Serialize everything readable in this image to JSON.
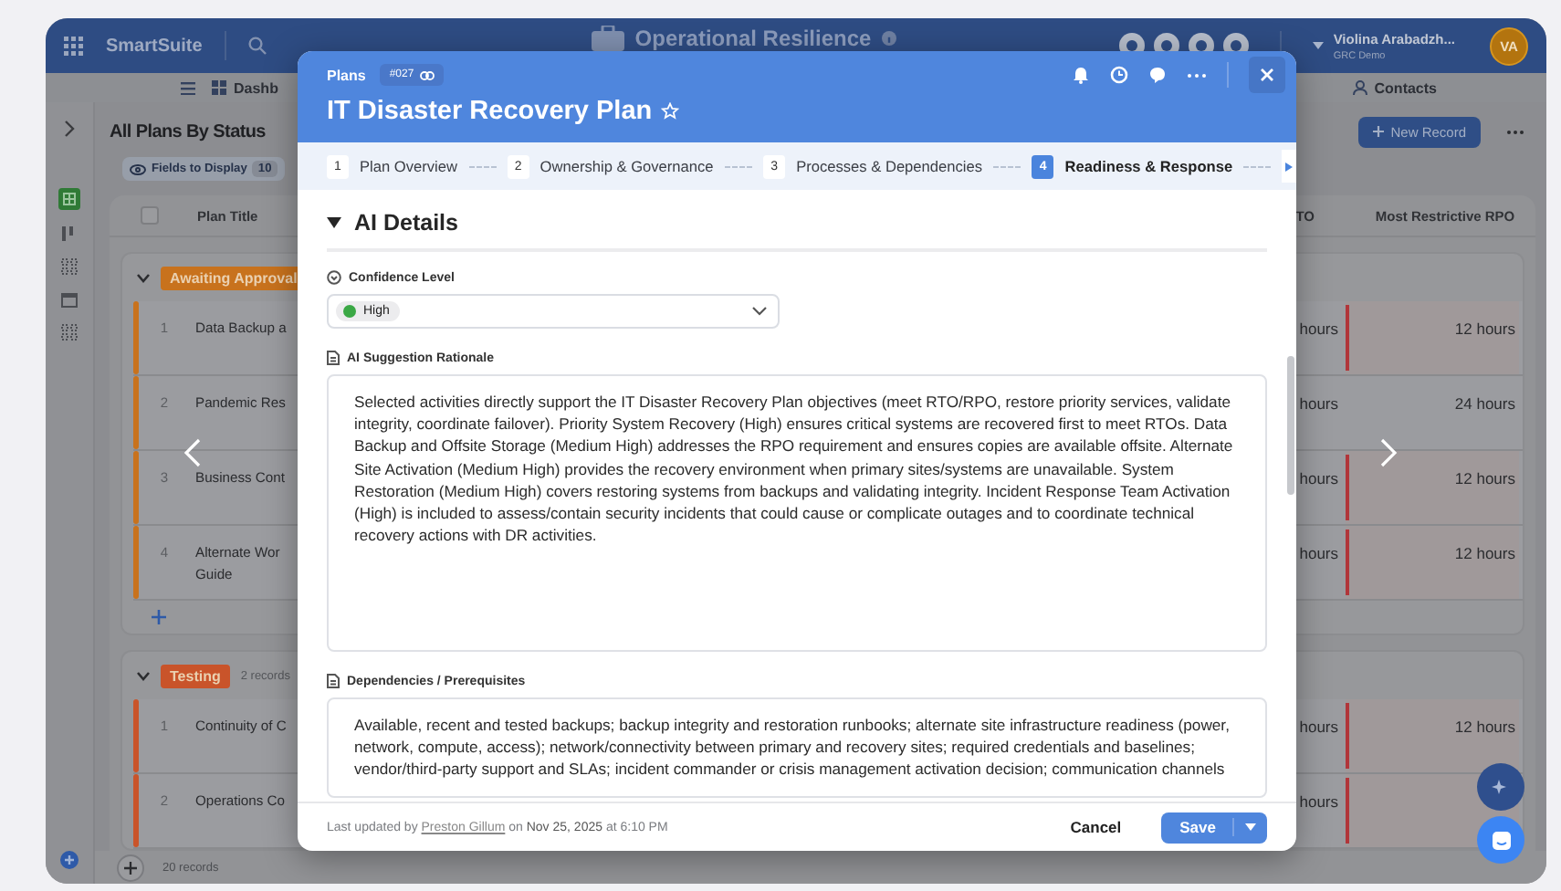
{
  "app": {
    "name": "SmartSuite",
    "workspace": "Operational Resilience",
    "user_name": "Violina Arabadzh...",
    "user_org": "GRC Demo",
    "avatar_initials": "VA"
  },
  "nav": [
    {
      "label": "Dashb"
    },
    {
      "label": "Contacts"
    }
  ],
  "view": {
    "title": "All Plans By Status",
    "fields_button": "Fields to Display",
    "fields_count": "10",
    "new_record_button": "New Record",
    "columns": [
      "Plan Title",
      "TO",
      "Most Restrictive RPO"
    ],
    "select_all_checked": false,
    "groups": [
      {
        "status": "Awaiting Approval",
        "color": "#c8721d",
        "expanded": true,
        "rows": [
          {
            "number": "1",
            "title": "Data Backup a",
            "rto": "hours",
            "rpo": "12 hours",
            "flagged": true
          },
          {
            "number": "2",
            "title": "Pandemic Res",
            "rto": "hours",
            "rpo": "24 hours",
            "flagged": false
          },
          {
            "number": "3",
            "title": "Business Cont",
            "rto": "hours",
            "rpo": "12 hours",
            "flagged": true
          },
          {
            "number": "4",
            "title": "Alternate Wor\nGuide",
            "rto": "hours",
            "rpo": "12 hours",
            "flagged": true
          }
        ]
      },
      {
        "status": "Testing",
        "color": "#c9542a",
        "expanded": true,
        "count": "2 records",
        "rows": [
          {
            "number": "1",
            "title": "Continuity of C",
            "rto": "hours",
            "rpo": "12 hours",
            "flagged": true
          },
          {
            "number": "2",
            "title": "Operations Co",
            "rto": "hours",
            "flagged": true
          }
        ]
      }
    ],
    "record_count": "20 records"
  },
  "modal": {
    "breadcrumb": "Plans",
    "record_id": "#027",
    "title": "IT Disaster Recovery Plan",
    "steps": [
      {
        "number": "1",
        "label": "Plan Overview",
        "selected": false
      },
      {
        "number": "2",
        "label": "Ownership & Governance",
        "selected": false
      },
      {
        "number": "3",
        "label": "Processes & Dependencies",
        "selected": false
      },
      {
        "number": "4",
        "label": "Readiness & Response",
        "selected": true
      }
    ],
    "section": {
      "title": "AI Details",
      "expanded": true
    },
    "fields": [
      {
        "kind": "select",
        "label": "Confidence Level",
        "value": "High",
        "color": "#3aa845"
      },
      {
        "kind": "textarea",
        "label": "AI Suggestion Rationale",
        "value": "Selected activities directly support the IT Disaster Recovery Plan objectives (meet RTO/RPO, restore priority services, validate integrity, coordinate failover). Priority System Recovery (High) ensures critical systems are recovered first to meet RTOs. Data Backup and Offsite Storage (Medium High) addresses the RPO requirement and ensures copies are available offsite. Alternate Site Activation (Medium High) provides the recovery environment when primary sites/systems are unavailable. System Restoration (Medium High) covers restoring systems from backups and validating integrity. Incident Response Team Activation (High) is included to assess/contain security incidents that could cause or complicate outages and to coordinate technical recovery actions with DR activities."
      },
      {
        "kind": "textarea",
        "label": "Dependencies / Prerequisites",
        "value": "Available, recent and tested backups; backup integrity and restoration runbooks; alternate site infrastructure readiness (power, network, compute, access); network/connectivity between primary and recovery sites; required credentials and baselines; vendor/third-party support and SLAs; incident commander or crisis management activation decision; communication channels"
      }
    ],
    "footer": {
      "prefix": "Last updated",
      "by": "by",
      "user": "Preston Gillum",
      "on": "on",
      "date": "Nov 25, 2025",
      "time": "at 6:10 PM"
    },
    "cancel_button": "Cancel",
    "save_button": "Save"
  }
}
